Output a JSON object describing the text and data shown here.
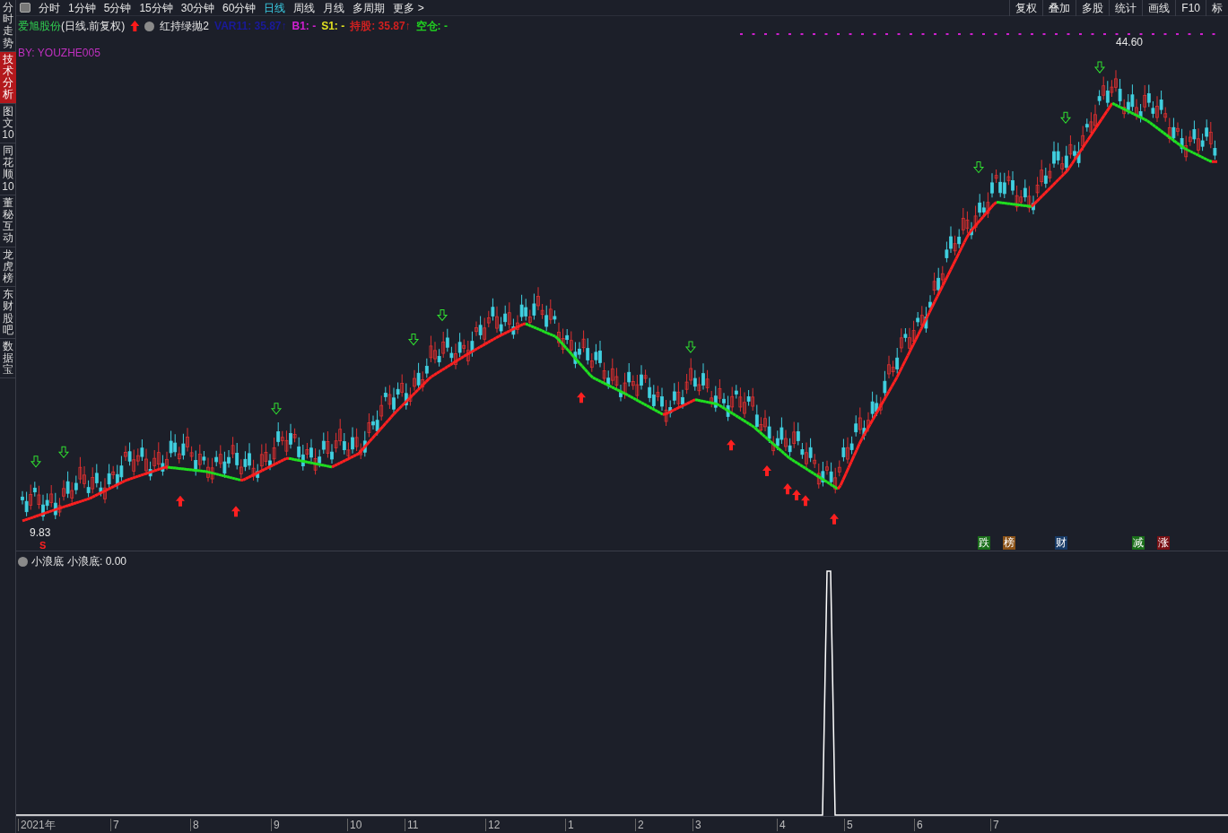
{
  "sidebar": {
    "items": [
      {
        "label": "分时走势",
        "selected": false
      },
      {
        "label": "技术分析",
        "selected": true
      },
      {
        "label": "图文10",
        "selected": false
      },
      {
        "label": "同花顺10",
        "selected": false
      },
      {
        "label": "董秘互动",
        "selected": false
      },
      {
        "label": "龙虎榜",
        "selected": false
      },
      {
        "label": "东财股吧",
        "selected": false
      },
      {
        "label": "数据宝",
        "selected": false
      }
    ]
  },
  "periods": [
    {
      "label": "分时",
      "selected": false
    },
    {
      "label": "1分钟",
      "selected": false
    },
    {
      "label": "5分钟",
      "selected": false
    },
    {
      "label": "15分钟",
      "selected": false
    },
    {
      "label": "30分钟",
      "selected": false
    },
    {
      "label": "60分钟",
      "selected": false
    },
    {
      "label": "日线",
      "selected": true
    },
    {
      "label": "周线",
      "selected": false
    },
    {
      "label": "月线",
      "selected": false
    },
    {
      "label": "多周期",
      "selected": false
    },
    {
      "label": "更多 >",
      "selected": false
    }
  ],
  "tools": [
    "复权",
    "叠加",
    "多股",
    "统计",
    "画线",
    "F10",
    "标"
  ],
  "legend": {
    "stock": "爱旭股份",
    "mode": "(日线.前复权)",
    "formula": "红持绿抛2",
    "values": [
      {
        "text": "VAR11: 35.87↑",
        "color": "#1a1a9a"
      },
      {
        "text": "B1: -",
        "color": "#d020d0"
      },
      {
        "text": "S1: -",
        "color": "#e0e020"
      },
      {
        "text": "持股: 35.87↑",
        "color": "#d02020"
      },
      {
        "text": "空仓: -",
        "color": "#20d020"
      }
    ],
    "author": "BY: YOUZHE005"
  },
  "price_high": "44.60",
  "price_low": "9.83",
  "s_marker": "S",
  "badges": [
    {
      "label": "跌",
      "color": "#1a6e1a"
    },
    {
      "label": "榜",
      "color": "#8a5218"
    },
    {
      "label": "财",
      "color": "#173a66"
    },
    {
      "label": "减",
      "color": "#1a6e1a"
    },
    {
      "label": "涨",
      "color": "#7a1014"
    }
  ],
  "indicator": {
    "name": "小浪底",
    "reading": "小浪底: 0.00"
  },
  "xaxis": [
    "2021年",
    "7",
    "8",
    "9",
    "10",
    "11",
    "12",
    "1",
    "2",
    "3",
    "4",
    "5",
    "6",
    "7"
  ]
}
